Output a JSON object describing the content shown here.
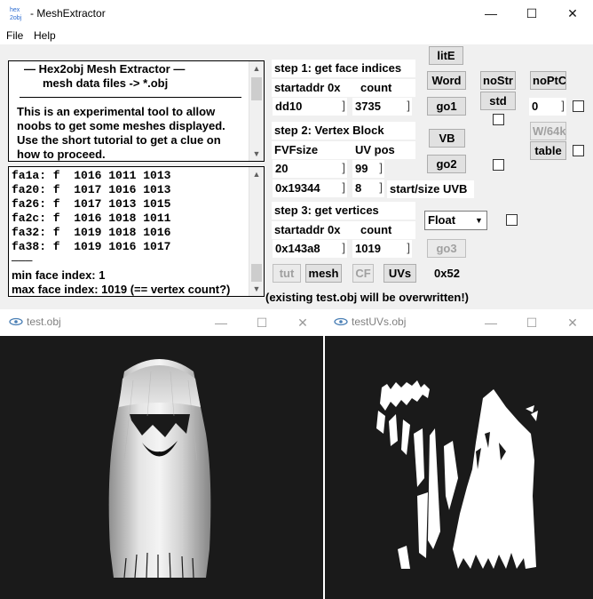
{
  "window": {
    "icon_text": "hex2obj",
    "title": "- MeshExtractor",
    "minimize_glyph": "—",
    "maximize_glyph": "☐",
    "close_glyph": "✕"
  },
  "menu": [
    "File",
    "Help"
  ],
  "info_panel": {
    "lines": [
      "—   Hex2obj Mesh Extractor   —",
      "mesh data files -> *.obj",
      "This is an experimental tool to allow",
      "noobs to get some meshes displayed.",
      "Use the short tutorial to get a clue on",
      "how to proceed."
    ]
  },
  "output_panel": {
    "lines": [
      "fa1a: f  1016 1011 1013",
      "fa20: f  1017 1016 1013",
      "fa26: f  1017 1013 1015",
      "fa2c: f  1016 1018 1011",
      "fa32: f  1019 1018 1016",
      "fa38: f  1019 1016 1017",
      "———",
      "min face index: 1",
      "max face index: 1019 (== vertex count?)"
    ]
  },
  "step1": {
    "label": "step 1: get face indices",
    "startaddr_label": "startaddr 0x",
    "count_label": "count",
    "startaddr_value": "dd10",
    "count_value": "3735"
  },
  "step2": {
    "label": "step 2: Vertex Block",
    "fvf_label": "FVFsize",
    "uvpos_label": "UV pos",
    "fvf_value": "20",
    "uvpos_value": "99",
    "uvb_start_value": "0x19344",
    "uvb_size_value": "8",
    "uvb_label": "start/size UVB"
  },
  "step3": {
    "label": "step 3: get vertices",
    "startaddr_label": "startaddr 0x",
    "count_label": "count",
    "startaddr_value": "0x143a8",
    "count_value": "1019"
  },
  "buttons": {
    "lite": "litE",
    "word": "Word",
    "go1": "go1",
    "vb": "VB",
    "go2": "go2",
    "go3": "go3",
    "nostr": "noStr",
    "std": "std",
    "noptc": "noPtC",
    "w64": "W/64k",
    "table": "table",
    "tut": "tut",
    "mesh": "mesh",
    "cf": "CF",
    "uvs": "UVs"
  },
  "right_field_value": "0",
  "float_select": "Float",
  "hex_readout": "0x52",
  "warning": "(existing test.obj will be overwritten!)",
  "viewer_left": {
    "title": "test.obj"
  },
  "viewer_right": {
    "title": "testUVs.obj"
  },
  "colors": {
    "window_bg": "#f0f0f0",
    "viewer_bg": "#1a1a1a",
    "mesh_color": "#e8e8e8",
    "uv_color": "#ffffff"
  }
}
